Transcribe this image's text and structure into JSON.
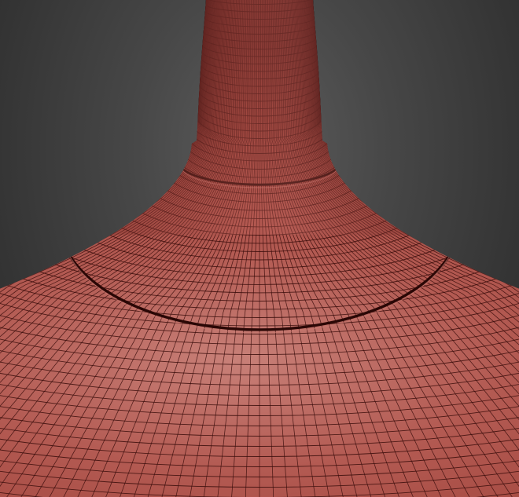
{
  "viewport": {
    "background_color": "#3a3a3a",
    "object": "wireframe-vase-mesh",
    "mesh_fill_color": "#b24a42",
    "mesh_highlight_color": "#c87a72",
    "wire_color": "#3a0d0b",
    "groove_color": "#2a0705"
  }
}
